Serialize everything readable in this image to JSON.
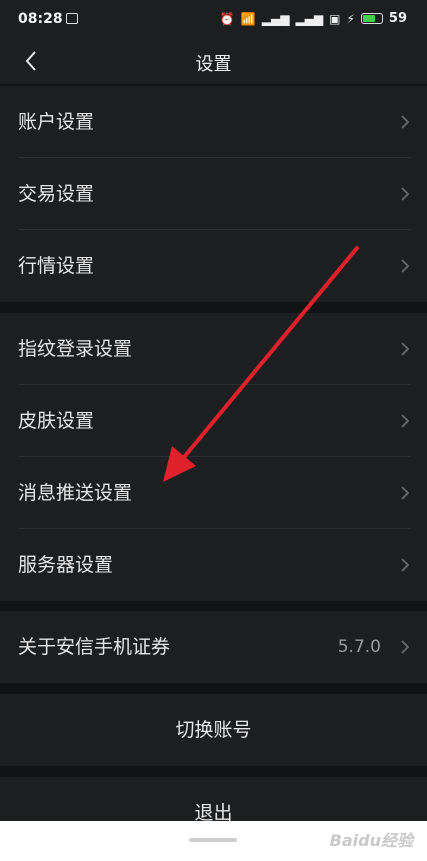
{
  "status_bar": {
    "time": "08:28",
    "battery": "59"
  },
  "header": {
    "title": "设置"
  },
  "groups": [
    {
      "items": [
        {
          "label": "账户设置"
        },
        {
          "label": "交易设置"
        },
        {
          "label": "行情设置"
        }
      ]
    },
    {
      "items": [
        {
          "label": "指纹登录设置"
        },
        {
          "label": "皮肤设置"
        },
        {
          "label": "消息推送设置"
        },
        {
          "label": "服务器设置"
        }
      ]
    },
    {
      "items": [
        {
          "label": "关于安信手机证券",
          "value": "5.7.0"
        }
      ]
    }
  ],
  "actions": {
    "switch_account": "切换账号",
    "logout": "退出"
  },
  "watermark": "Baidu经验",
  "colors": {
    "background": "#111214",
    "panel": "#1d1e20",
    "arrow": "#e0212c"
  }
}
